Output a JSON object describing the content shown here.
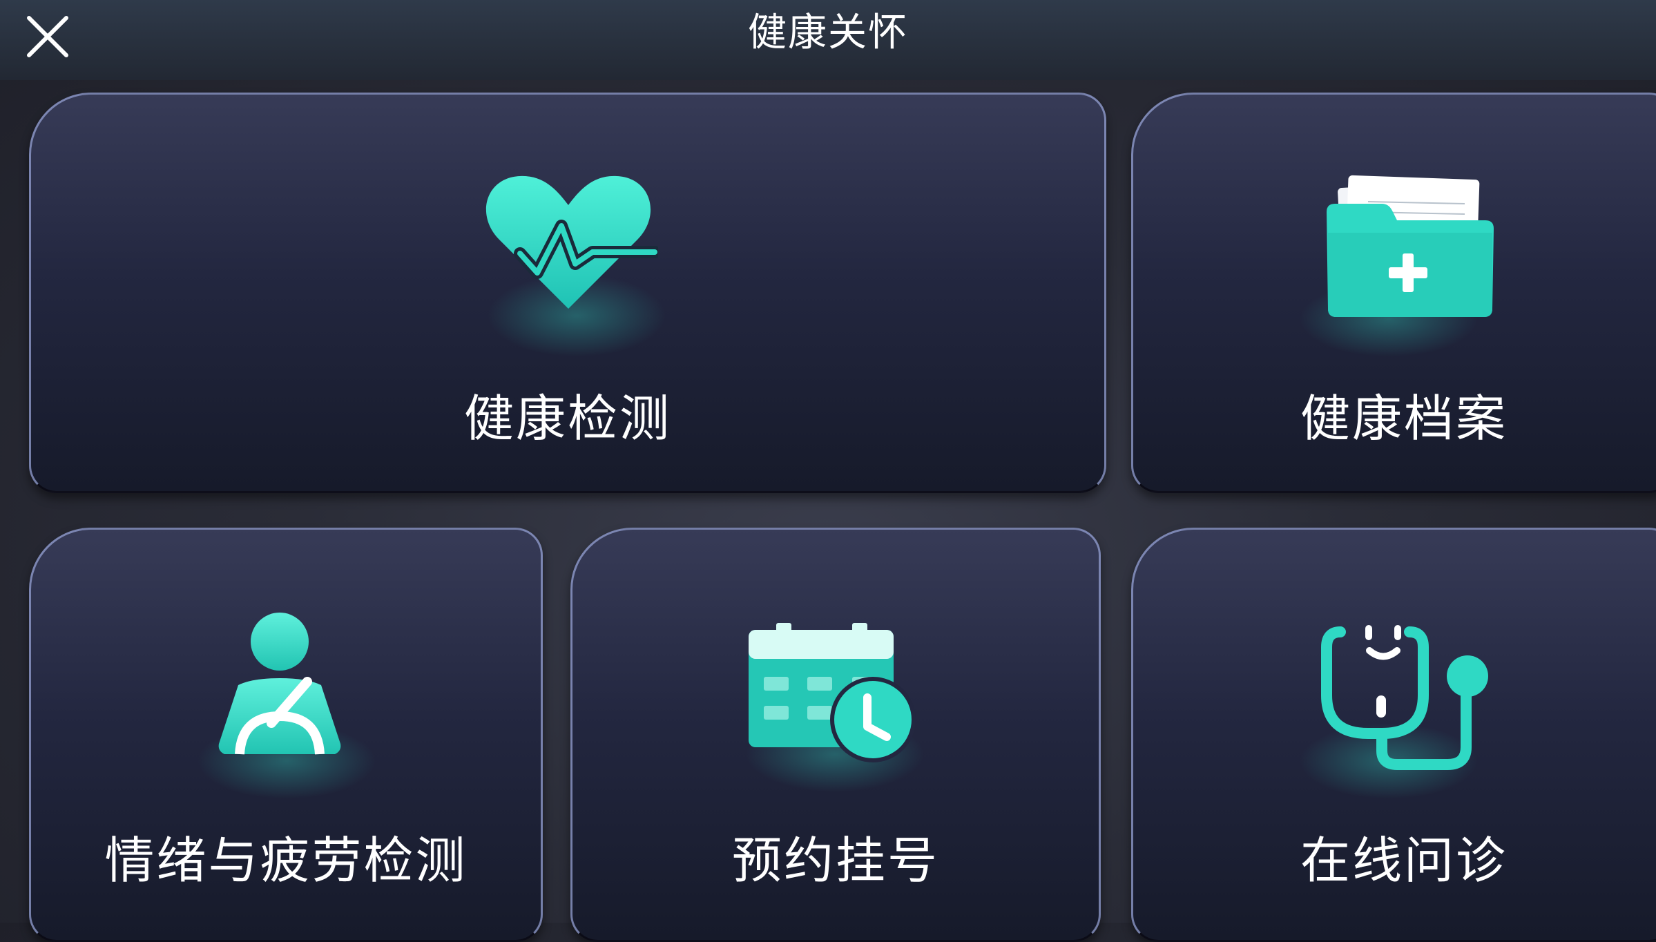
{
  "header": {
    "title": "健康关怀",
    "close_icon": "close-icon"
  },
  "cards": {
    "health_check": {
      "label": "健康检测",
      "icon": "heartbeat-icon"
    },
    "health_records": {
      "label": "健康档案",
      "icon": "medical-folder-icon"
    },
    "emotion_fatigue": {
      "label": "情绪与疲劳检测",
      "icon": "person-seatbelt-icon"
    },
    "appointment": {
      "label": "预约挂号",
      "icon": "calendar-clock-icon"
    },
    "online_consult": {
      "label": "在线问诊",
      "icon": "stethoscope-icon"
    }
  },
  "colors": {
    "accent": "#2fd9c4",
    "accent_light": "#5ff0dc",
    "card_border": "#9aa2d2",
    "background": "#2a2c37"
  }
}
